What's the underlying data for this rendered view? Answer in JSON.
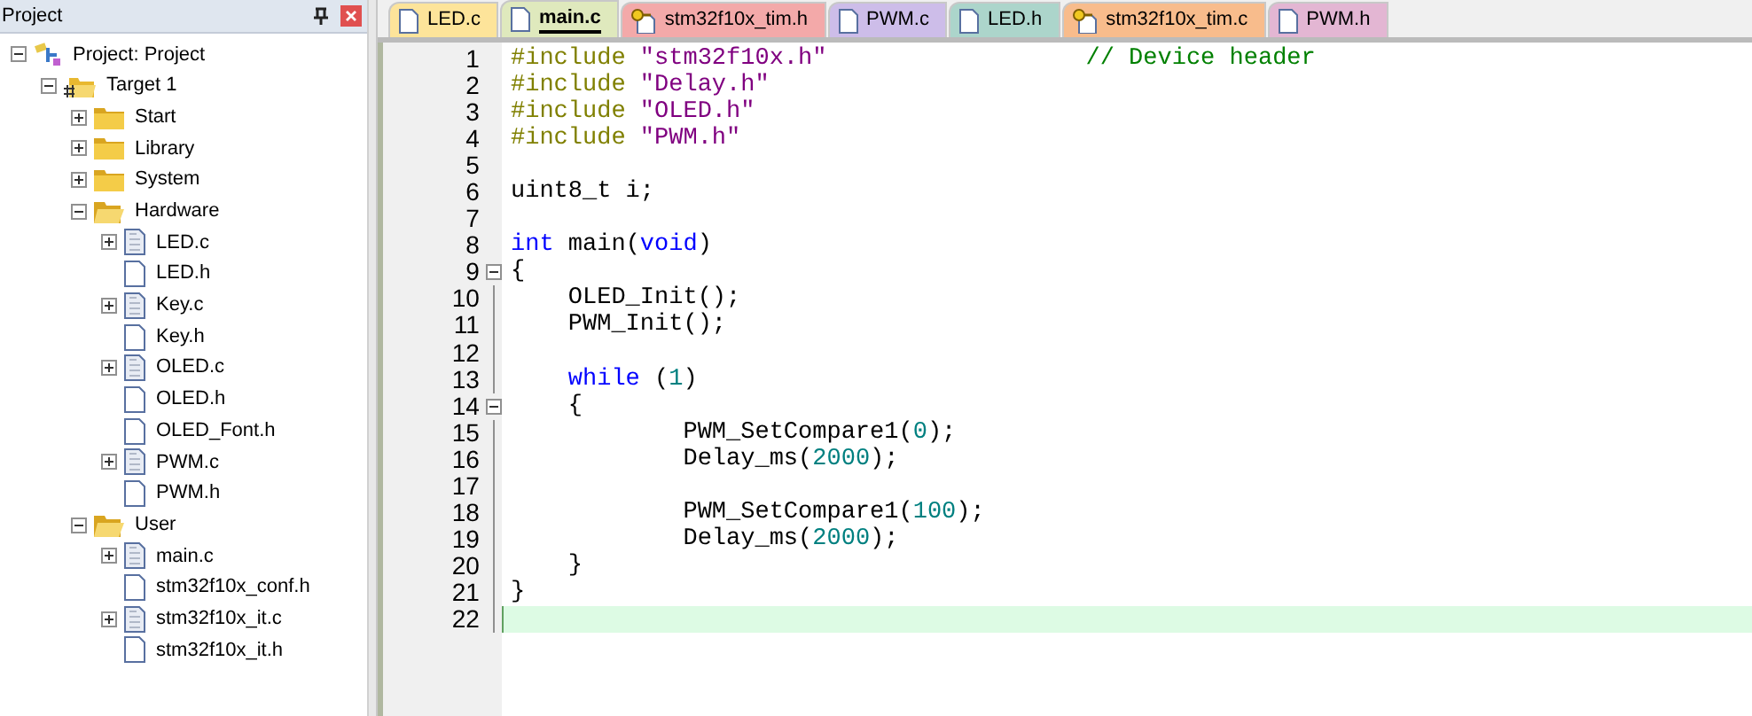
{
  "project_pane": {
    "title": "Project",
    "tree": [
      {
        "kind": "project",
        "label": "Project: Project",
        "expanded": true,
        "children": [
          {
            "kind": "target",
            "label": "Target 1",
            "expanded": true,
            "children": [
              {
                "kind": "folder",
                "label": "Start",
                "expanded": false
              },
              {
                "kind": "folder",
                "label": "Library",
                "expanded": false
              },
              {
                "kind": "folder",
                "label": "System",
                "expanded": false
              },
              {
                "kind": "folder",
                "label": "Hardware",
                "expanded": true,
                "children": [
                  {
                    "kind": "source",
                    "label": "LED.c",
                    "expanded": false
                  },
                  {
                    "kind": "header",
                    "label": "LED.h"
                  },
                  {
                    "kind": "source",
                    "label": "Key.c",
                    "expanded": false
                  },
                  {
                    "kind": "header",
                    "label": "Key.h"
                  },
                  {
                    "kind": "source",
                    "label": "OLED.c",
                    "expanded": false
                  },
                  {
                    "kind": "header",
                    "label": "OLED.h"
                  },
                  {
                    "kind": "header",
                    "label": "OLED_Font.h"
                  },
                  {
                    "kind": "source",
                    "label": "PWM.c",
                    "expanded": false
                  },
                  {
                    "kind": "header",
                    "label": "PWM.h"
                  }
                ]
              },
              {
                "kind": "folder",
                "label": "User",
                "expanded": true,
                "children": [
                  {
                    "kind": "source",
                    "label": "main.c",
                    "expanded": false
                  },
                  {
                    "kind": "header",
                    "label": "stm32f10x_conf.h"
                  },
                  {
                    "kind": "source",
                    "label": "stm32f10x_it.c",
                    "expanded": false
                  },
                  {
                    "kind": "header",
                    "label": "stm32f10x_it.h"
                  }
                ]
              }
            ]
          }
        ]
      }
    ]
  },
  "tabs": [
    {
      "label": "LED.c",
      "color": "#fde49a",
      "locked": false,
      "selected": false
    },
    {
      "label": "main.c",
      "color": "#dfe9bd",
      "locked": false,
      "selected": true
    },
    {
      "label": "stm32f10x_tim.h",
      "color": "#f3a9a9",
      "locked": true,
      "selected": false
    },
    {
      "label": "PWM.c",
      "color": "#cdbde9",
      "locked": false,
      "selected": false
    },
    {
      "label": "LED.h",
      "color": "#acd5cb",
      "locked": false,
      "selected": false
    },
    {
      "label": "stm32f10x_tim.c",
      "color": "#f8bc8c",
      "locked": true,
      "selected": false
    },
    {
      "label": "PWM.h",
      "color": "#e3b6d3",
      "locked": false,
      "selected": false
    }
  ],
  "editor": {
    "lines": [
      {
        "number": "1",
        "fold_box": false,
        "current": false,
        "segments": [
          {
            "kind": "preprocessor",
            "text": "#include "
          },
          {
            "kind": "string",
            "text": "\"stm32f10x.h\""
          }
        ],
        "comment": "// Device header"
      },
      {
        "number": "2",
        "fold_box": false,
        "current": false,
        "segments": [
          {
            "kind": "preprocessor",
            "text": "#include "
          },
          {
            "kind": "string",
            "text": "\"Delay.h\""
          }
        ]
      },
      {
        "number": "3",
        "fold_box": false,
        "current": false,
        "segments": [
          {
            "kind": "preprocessor",
            "text": "#include "
          },
          {
            "kind": "string",
            "text": "\"OLED.h\""
          }
        ]
      },
      {
        "number": "4",
        "fold_box": false,
        "current": false,
        "segments": [
          {
            "kind": "preprocessor",
            "text": "#include "
          },
          {
            "kind": "string",
            "text": "\"PWM.h\""
          }
        ]
      },
      {
        "number": "5",
        "fold_box": false,
        "current": false
      },
      {
        "number": "6",
        "fold_box": false,
        "current": false,
        "segments": [
          {
            "kind": "plain",
            "text": "uint8_t i;"
          }
        ]
      },
      {
        "number": "7",
        "fold_box": false,
        "current": false
      },
      {
        "number": "8",
        "fold_box": false,
        "current": false,
        "segments": [
          {
            "kind": "keyword",
            "text": "int"
          },
          {
            "kind": "plain",
            "text": " main("
          },
          {
            "kind": "keyword",
            "text": "void"
          },
          {
            "kind": "plain",
            "text": ")"
          }
        ]
      },
      {
        "number": "9",
        "fold_box": true,
        "current": false,
        "segments": [
          {
            "kind": "plain",
            "text": "{"
          }
        ]
      },
      {
        "number": "10",
        "fold_box": false,
        "current": false,
        "segments": [
          {
            "kind": "plain",
            "text": "    OLED_Init();"
          }
        ]
      },
      {
        "number": "11",
        "fold_box": false,
        "current": false,
        "segments": [
          {
            "kind": "plain",
            "text": "    PWM_Init();"
          }
        ]
      },
      {
        "number": "12",
        "fold_box": false,
        "current": false
      },
      {
        "number": "13",
        "fold_box": false,
        "current": false,
        "segments": [
          {
            "kind": "keyword",
            "text": "    while"
          },
          {
            "kind": "plain",
            "text": " ("
          },
          {
            "kind": "number",
            "text": "1"
          },
          {
            "kind": "plain",
            "text": ")"
          }
        ]
      },
      {
        "number": "14",
        "fold_box": true,
        "current": false,
        "segments": [
          {
            "kind": "plain",
            "text": "    {"
          }
        ]
      },
      {
        "number": "15",
        "fold_box": false,
        "current": false,
        "segments": [
          {
            "kind": "plain",
            "text": "            PWM_SetCompare1("
          },
          {
            "kind": "number",
            "text": "0"
          },
          {
            "kind": "plain",
            "text": ");"
          }
        ]
      },
      {
        "number": "16",
        "fold_box": false,
        "current": false,
        "segments": [
          {
            "kind": "plain",
            "text": "            Delay_ms("
          },
          {
            "kind": "number",
            "text": "2000"
          },
          {
            "kind": "plain",
            "text": ");"
          }
        ]
      },
      {
        "number": "17",
        "fold_box": false,
        "current": false
      },
      {
        "number": "18",
        "fold_box": false,
        "current": false,
        "segments": [
          {
            "kind": "plain",
            "text": "            PWM_SetCompare1("
          },
          {
            "kind": "number",
            "text": "100"
          },
          {
            "kind": "plain",
            "text": ");"
          }
        ]
      },
      {
        "number": "19",
        "fold_box": false,
        "current": false,
        "segments": [
          {
            "kind": "plain",
            "text": "            Delay_ms("
          },
          {
            "kind": "number",
            "text": "2000"
          },
          {
            "kind": "plain",
            "text": ");"
          }
        ]
      },
      {
        "number": "20",
        "fold_box": false,
        "current": false,
        "segments": [
          {
            "kind": "plain",
            "text": "    }"
          }
        ]
      },
      {
        "number": "21",
        "fold_box": false,
        "current": false,
        "segments": [
          {
            "kind": "plain",
            "text": "}"
          }
        ]
      },
      {
        "number": "22",
        "fold_box": false,
        "current": true
      }
    ]
  }
}
